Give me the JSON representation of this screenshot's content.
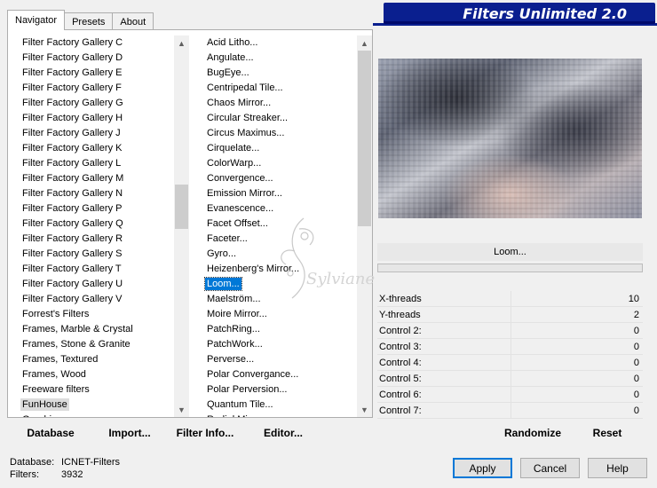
{
  "tabs": [
    {
      "label": "Navigator",
      "active": true
    },
    {
      "label": "Presets",
      "active": false
    },
    {
      "label": "About",
      "active": false
    }
  ],
  "banner": {
    "title": "Filters Unlimited 2.0"
  },
  "categories": [
    "Filter Factory Gallery C",
    "Filter Factory Gallery D",
    "Filter Factory Gallery E",
    "Filter Factory Gallery F",
    "Filter Factory Gallery G",
    "Filter Factory Gallery H",
    "Filter Factory Gallery J",
    "Filter Factory Gallery K",
    "Filter Factory Gallery L",
    "Filter Factory Gallery M",
    "Filter Factory Gallery N",
    "Filter Factory Gallery P",
    "Filter Factory Gallery Q",
    "Filter Factory Gallery R",
    "Filter Factory Gallery S",
    "Filter Factory Gallery T",
    "Filter Factory Gallery U",
    "Filter Factory Gallery V",
    "Forrest's Filters",
    "Frames, Marble & Crystal",
    "Frames, Stone & Granite",
    "Frames, Textured",
    "Frames, Wood",
    "Freeware filters",
    "FunHouse",
    "Graphics..."
  ],
  "selected_category": "FunHouse",
  "filters": [
    "Acid Litho...",
    "Angulate...",
    "BugEye...",
    "Centripedal Tile...",
    "Chaos Mirror...",
    "Circular Streaker...",
    "Circus Maximus...",
    "Cirquelate...",
    "ColorWarp...",
    "Convergence...",
    "Emission Mirror...",
    "Evanescence...",
    "Facet Offset...",
    "Faceter...",
    "Gyro...",
    "Heizenberg's Mirror...",
    "Loom...",
    "Maelström...",
    "Moire Mirror...",
    "PatchRing...",
    "PatchWork...",
    "Perverse...",
    "Polar Convergance...",
    "Polar Perversion...",
    "Quantum Tile...",
    "Radial Mirror..."
  ],
  "selected_filter": "Loom...",
  "left_buttons": {
    "database": "Database",
    "import": "Import...",
    "filter_info": "Filter Info...",
    "editor": "Editor..."
  },
  "current_filter_name": "Loom...",
  "progress_fraction": 0,
  "controls": [
    {
      "name": "X-threads",
      "value": "10"
    },
    {
      "name": "Y-threads",
      "value": "2"
    },
    {
      "name": "Control 2:",
      "value": "0"
    },
    {
      "name": "Control 3:",
      "value": "0"
    },
    {
      "name": "Control 4:",
      "value": "0"
    },
    {
      "name": "Control 5:",
      "value": "0"
    },
    {
      "name": "Control 6:",
      "value": "0"
    },
    {
      "name": "Control 7:",
      "value": "0"
    }
  ],
  "right_buttons": {
    "randomize": "Randomize",
    "reset": "Reset"
  },
  "status": {
    "database_label": "Database:",
    "database_value": "ICNET-Filters",
    "filters_label": "Filters:",
    "filters_value": "3932"
  },
  "dialog_buttons": {
    "apply": "Apply",
    "cancel": "Cancel",
    "help": "Help"
  },
  "watermark_text": "Sylviane",
  "colors": {
    "banner": "#0a1f8f",
    "selection": "#0078d7",
    "apply_border": "#0078d7"
  }
}
